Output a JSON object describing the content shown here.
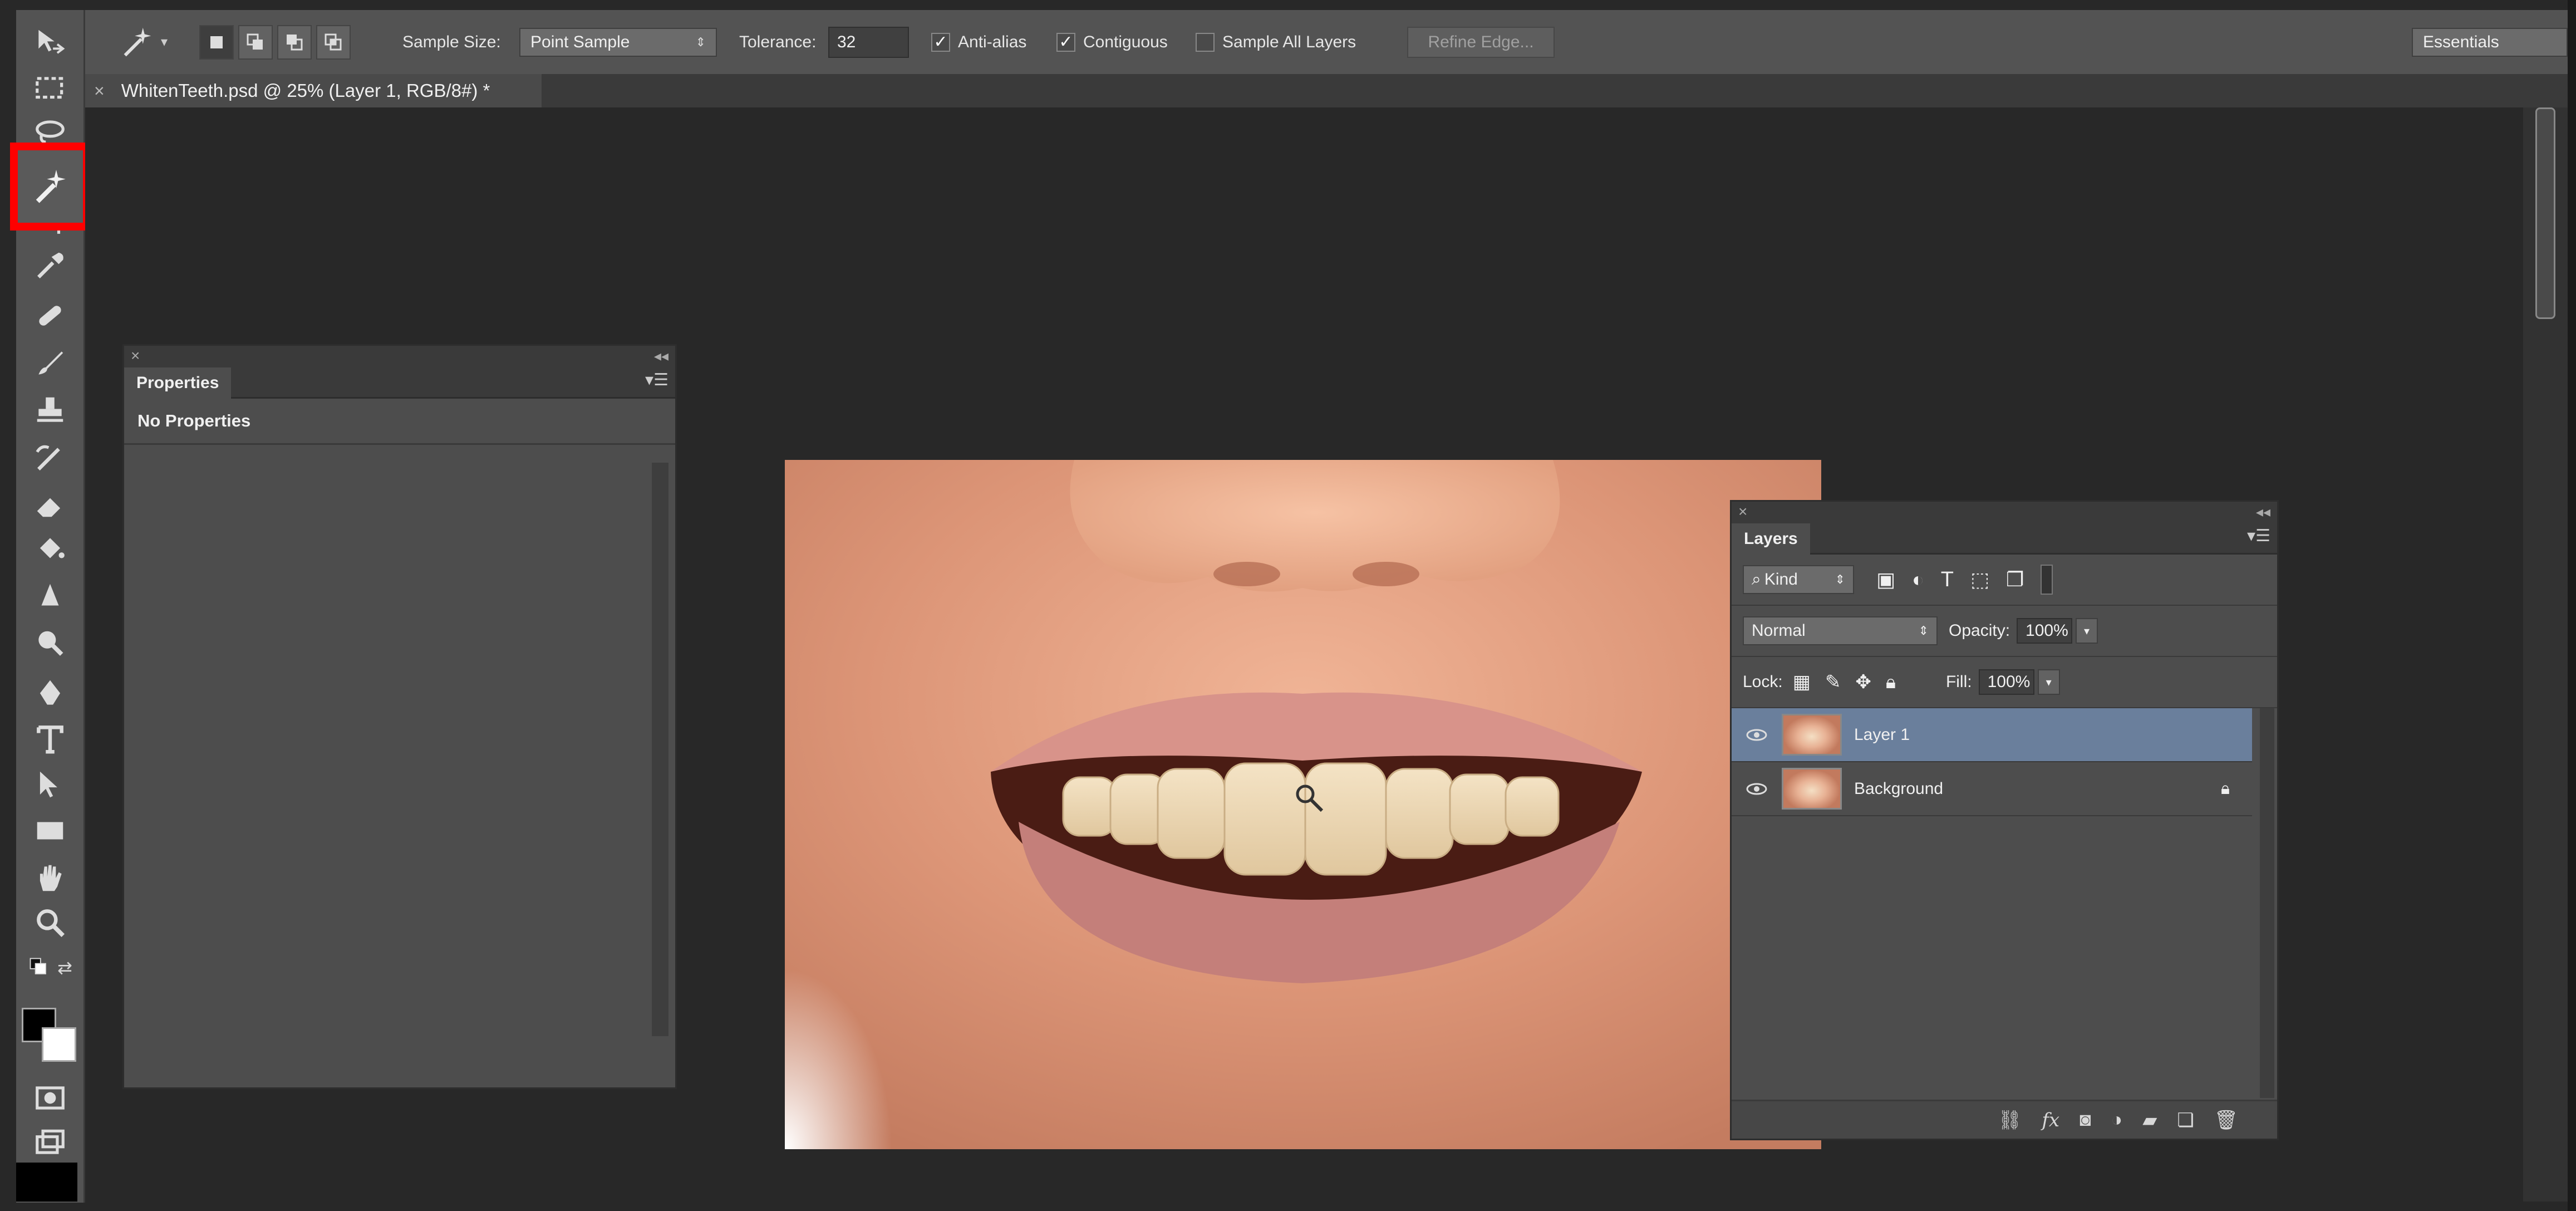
{
  "options_bar": {
    "sample_size_label": "Sample Size:",
    "sample_size_value": "Point Sample",
    "tolerance_label": "Tolerance:",
    "tolerance_value": "32",
    "anti_alias_label": "Anti-alias",
    "contiguous_label": "Contiguous",
    "sample_all_layers_label": "Sample All Layers",
    "refine_edge_label": "Refine Edge...",
    "workspace_value": "Essentials"
  },
  "document": {
    "tab_title": "WhitenTeeth.psd @ 25% (Layer 1, RGB/8#) *",
    "close_glyph": "×"
  },
  "properties_panel": {
    "tab_label": "Properties",
    "body_text": "No Properties"
  },
  "layers_panel": {
    "tab_label": "Layers",
    "kind_label": "Kind",
    "blend_mode": "Normal",
    "opacity_label": "Opacity:",
    "opacity_value": "100%",
    "lock_label": "Lock:",
    "fill_label": "Fill:",
    "fill_value": "100%",
    "layers": [
      {
        "name": "Layer 1",
        "selected": true
      },
      {
        "name": "Background",
        "selected": false
      }
    ]
  },
  "toolbar": {
    "active_tool": "magic-wand-icon",
    "highlight_color": "#ff0000"
  }
}
